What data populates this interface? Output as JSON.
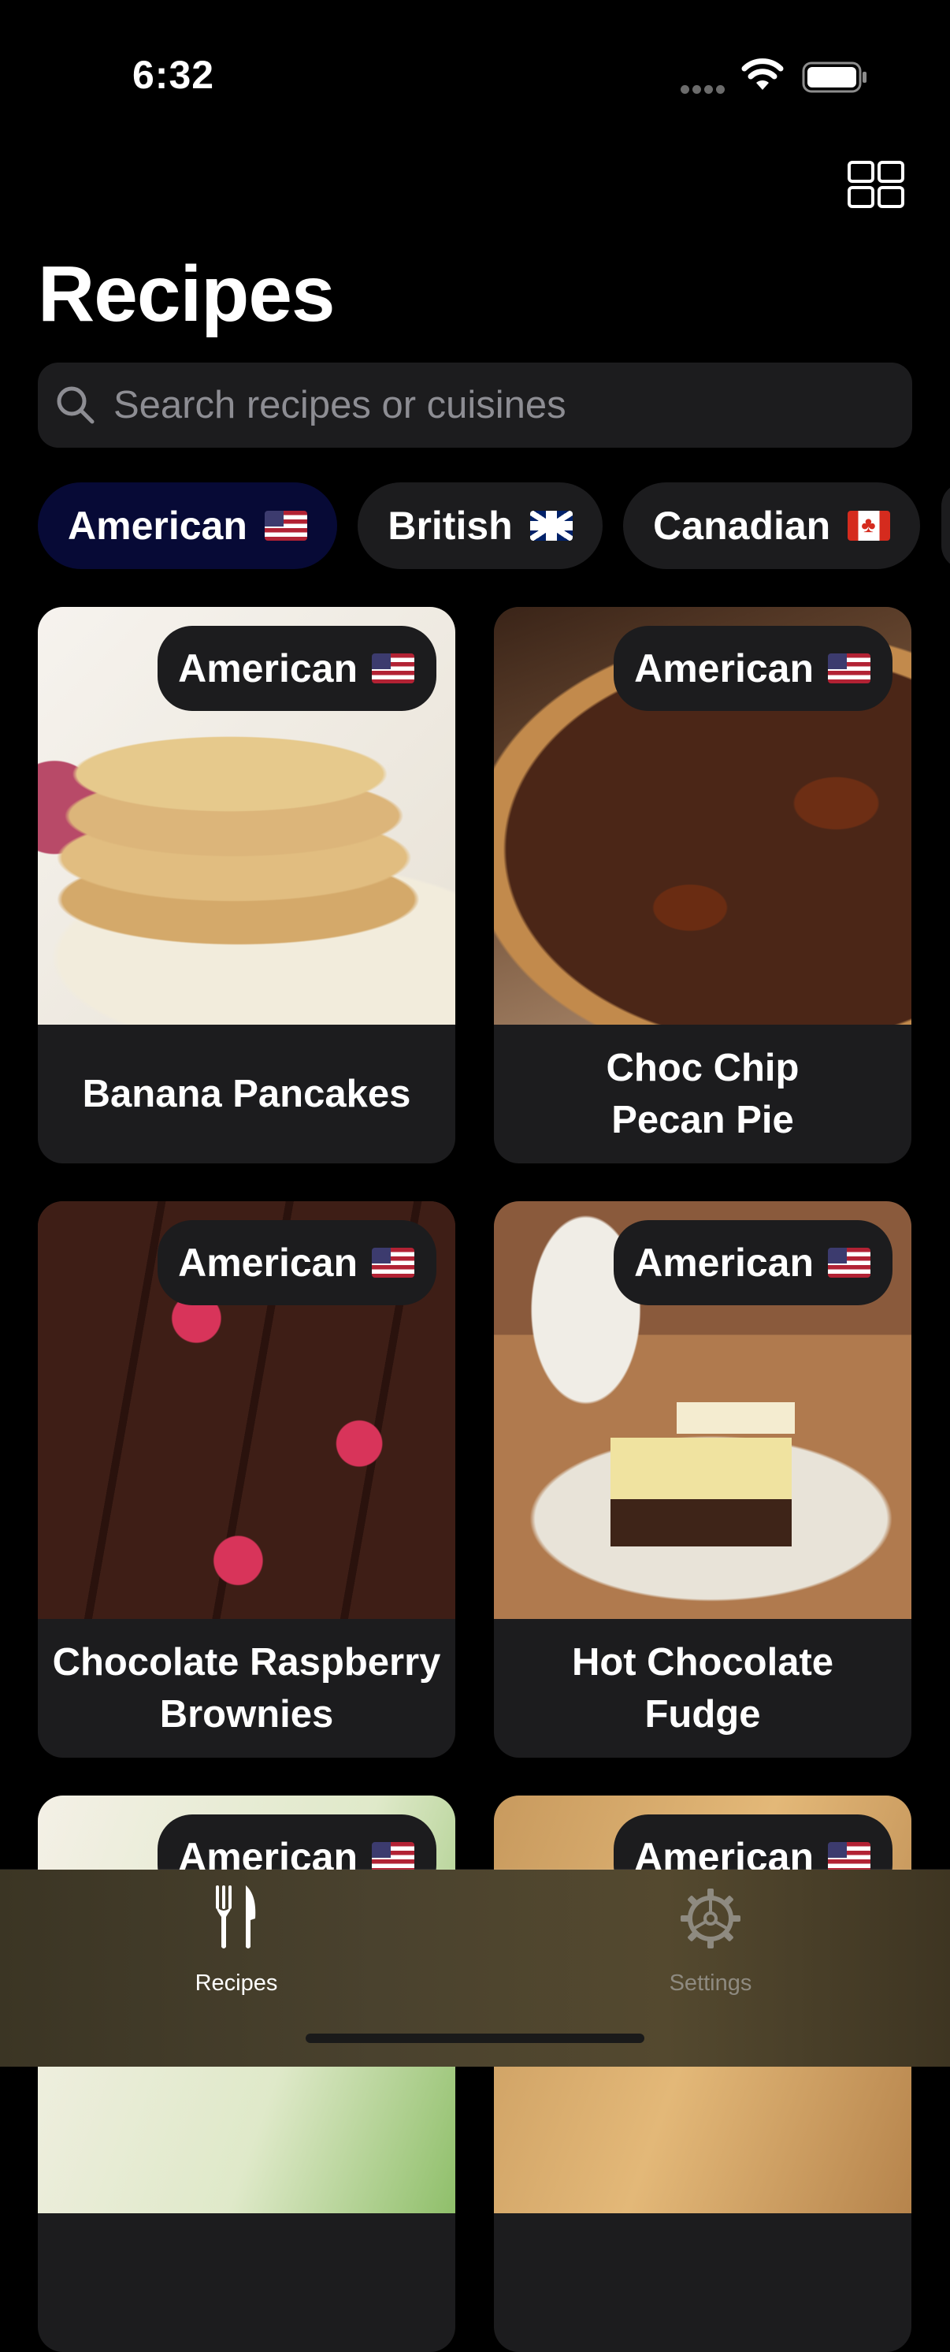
{
  "status_bar": {
    "time": "6:32"
  },
  "header": {
    "title": "Recipes"
  },
  "search": {
    "placeholder": "Search recipes or cuisines"
  },
  "filters": [
    {
      "label": "American",
      "flag": "us-flag",
      "selected": true
    },
    {
      "label": "British",
      "flag": "gb-flag",
      "selected": false
    },
    {
      "label": "Canadian",
      "flag": "ca-flag",
      "selected": false
    }
  ],
  "recipes": [
    {
      "name": "Banana Pancakes",
      "cuisine": "American"
    },
    {
      "name": "Choc Chip Pecan Pie",
      "cuisine": "American"
    },
    {
      "name": "Chocolate Raspberry Brownies",
      "cuisine": "American"
    },
    {
      "name": "Hot Chocolate Fudge",
      "cuisine": "American"
    },
    {
      "name": "",
      "cuisine": "American"
    },
    {
      "name": "",
      "cuisine": "American"
    }
  ],
  "tab_bar": {
    "tabs": [
      {
        "label": "Recipes",
        "icon": "fork-knife-icon",
        "active": true
      },
      {
        "label": "Settings",
        "icon": "gear-icon",
        "active": false
      }
    ]
  },
  "colors": {
    "background": "#000000",
    "card": "#1c1c1e",
    "selected_chip": "#070a36",
    "inactive_tab": "#8e8a80"
  }
}
